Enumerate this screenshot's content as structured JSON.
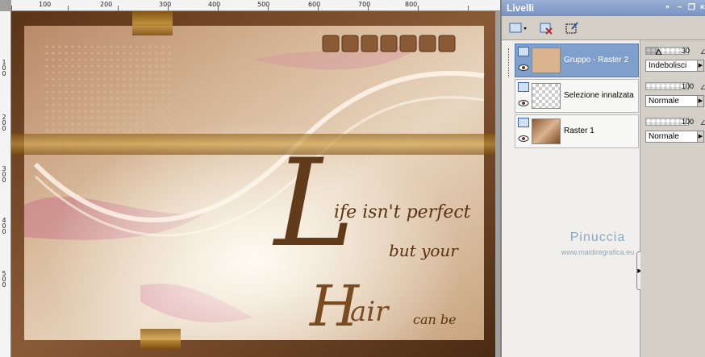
{
  "ruler": {
    "top_labels": [
      "100",
      "200",
      "300",
      "400",
      "500",
      "600",
      "700",
      "800"
    ],
    "left_labels": [
      "100",
      "200",
      "300",
      "400",
      "500"
    ]
  },
  "artwork": {
    "script_big_L": "L",
    "line1": "ife isn't perfect",
    "line2": "but your",
    "script_big_H": "H",
    "line3": "air",
    "line4": "can be"
  },
  "panel": {
    "title": "Livelli",
    "titlebar_icons": [
      "pin-icon",
      "minimize-icon",
      "restore-icon",
      "close-icon"
    ],
    "toolbar": [
      "new-layer-icon",
      "delete-layer-icon",
      "mask-icon"
    ]
  },
  "layers": [
    {
      "name": "Gruppo - Raster 2",
      "opacity": 30,
      "blend": "Indebolisci",
      "selected": true
    },
    {
      "name": "Selezione innalzata",
      "opacity": 100,
      "blend": "Normale",
      "selected": false
    },
    {
      "name": "Raster 1",
      "opacity": 100,
      "blend": "Normale",
      "selected": false
    }
  ],
  "watermark": {
    "name": "Pinuccia",
    "url": "www.maidiregrafica.eu"
  },
  "colors": {
    "selected_row": "#7fa0cc",
    "titlebar": "#7892c2",
    "script_text": "#5a3210"
  }
}
